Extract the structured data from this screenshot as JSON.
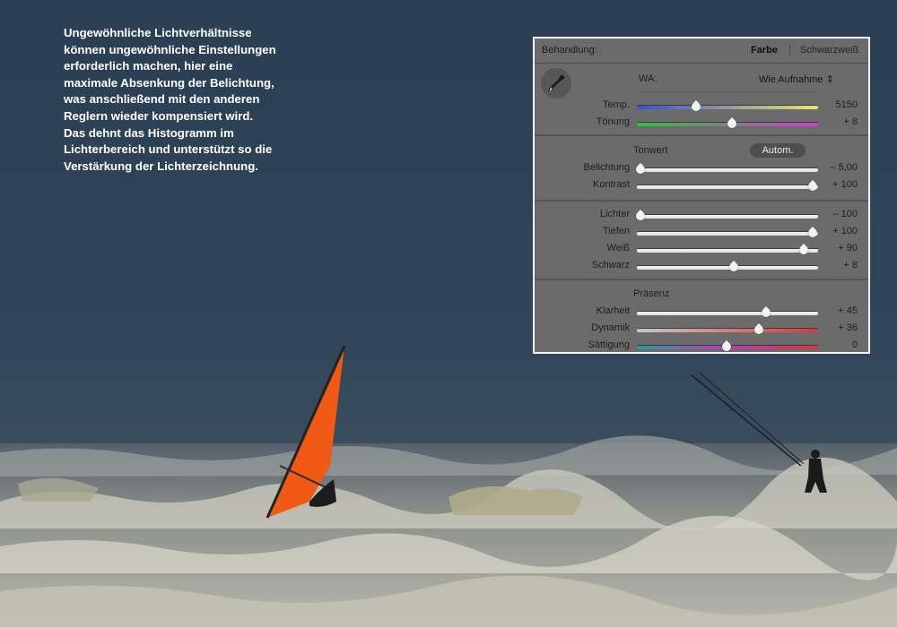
{
  "caption": {
    "lines": [
      "Ungewöhnliche Lichtverhältnisse",
      "können ungewöhnliche Einstellungen",
      "erforderlich machen, hier eine",
      "maximale Absenkung der Belichtung,",
      "was anschließend mit den anderen",
      "Reglern wieder kompensiert wird.",
      "Das dehnt das Histogramm im",
      "Lichterbereich und unterstützt so die",
      "Verstärkung der Lichterzeichnung."
    ]
  },
  "panel": {
    "header": {
      "title": "Behandlung:",
      "farbe": "Farbe",
      "separator": "|",
      "schwarzweiss": "Schwarzweiß"
    },
    "wa": {
      "label": "WA:",
      "value": "Wie Aufnahme",
      "dropper_icon": "eyedropper-icon"
    },
    "sliders_wb": [
      {
        "label": "Temp.",
        "value": "5150",
        "position": 0.33,
        "track": "temp"
      },
      {
        "label": "Tönung",
        "value": "+ 8",
        "position": 0.53,
        "track": "tint"
      }
    ],
    "tonwert": {
      "label": "Tonwert",
      "auto_button": "Autom."
    },
    "sliders_tone": [
      {
        "label": "Belichtung",
        "value": "– 5,00",
        "position": 0.02,
        "track": "gray"
      },
      {
        "label": "Kontrast",
        "value": "+ 100",
        "position": 0.98,
        "track": "gray"
      }
    ],
    "sliders_light": [
      {
        "label": "Lichter",
        "value": "– 100",
        "position": 0.02,
        "track": "gray"
      },
      {
        "label": "Tiefen",
        "value": "+ 100",
        "position": 0.98,
        "track": "gray"
      },
      {
        "label": "Weiß",
        "value": "+ 90",
        "position": 0.93,
        "track": "gray"
      },
      {
        "label": "Schwarz",
        "value": "+ 8",
        "position": 0.54,
        "track": "gray"
      }
    ],
    "praesenz": {
      "label": "Präsenz"
    },
    "sliders_presence": [
      {
        "label": "Klarheit",
        "value": "+ 45",
        "position": 0.72,
        "track": "gray"
      },
      {
        "label": "Dynamik",
        "value": "+ 36",
        "position": 0.68,
        "track": "dyn"
      },
      {
        "label": "Sättigung",
        "value": "0",
        "position": 0.5,
        "track": "sat"
      }
    ]
  },
  "colors": {
    "sky": "#2e4256",
    "sail": "#f05a14",
    "panel": "#6b6b6b"
  }
}
